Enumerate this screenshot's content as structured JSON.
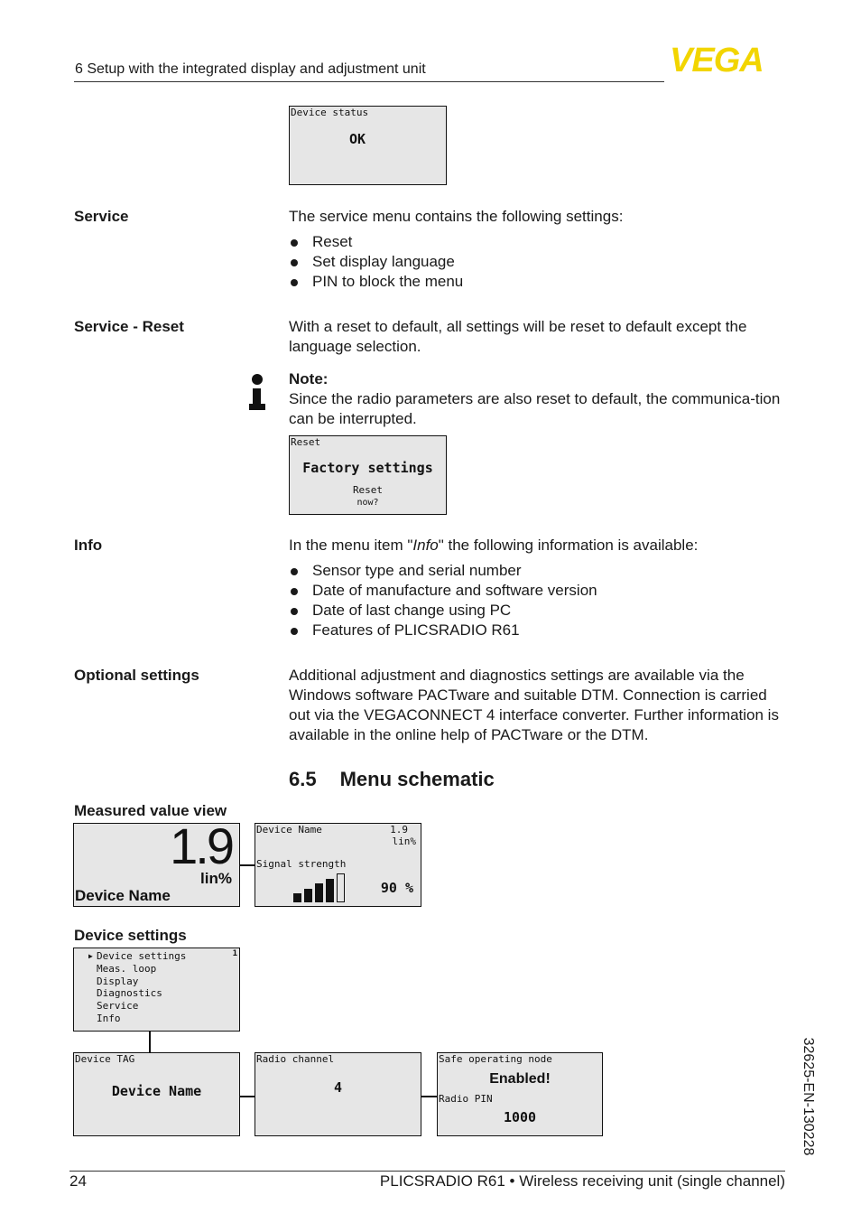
{
  "header": {
    "title": "6 Setup with the integrated display and adjustment unit",
    "logo": "VEGA",
    "brand_color": "#f2d500"
  },
  "device_status_display": {
    "title": "Device status",
    "value": "OK"
  },
  "sections": [
    {
      "label": "Service",
      "text": "The service menu contains the following settings:",
      "bullets": [
        "Reset",
        "Set display language",
        "PIN to block the menu"
      ]
    },
    {
      "label": "Service - Reset",
      "text": "With a reset to default, all settings will be reset to default except the language selection."
    },
    {
      "label": "Info",
      "text_before": "In the menu item \"",
      "text_italic": "Info",
      "text_after": "\" the following information is available:",
      "bullets": [
        "Sensor type and serial number",
        "Date of manufacture and software version",
        "Date of last change using PC",
        "Features of PLICSRADIO R61"
      ]
    },
    {
      "label": "Optional settings",
      "text": "Additional adjustment and diagnostics settings are available via the Windows software PACTware and suitable DTM. Connection is carried out via the VEGACONNECT 4 interface converter. Further information is available in the online help of PACTware or the DTM."
    }
  ],
  "note": {
    "icon": "info-icon",
    "title": "Note:",
    "text": "Since the radio parameters are also reset to default, the communica-tion can be interrupted."
  },
  "reset_display": {
    "title": "Reset",
    "value": "Factory settings",
    "line1": "Reset",
    "line2": "now?"
  },
  "section_heading": {
    "number": "6.5",
    "title": "Menu schematic"
  },
  "measured_value_view": {
    "heading": "Measured value view",
    "value": "1.9",
    "unit": "lin%",
    "name": "Device Name",
    "detail": {
      "name": "Device Name",
      "value": "1.9",
      "unit": "lin%",
      "signal_label": "Signal strength",
      "signal_percent": "90 %",
      "signal_bars_filled": 4,
      "signal_bars_total": 5
    }
  },
  "device_settings": {
    "heading": "Device settings",
    "page": "1",
    "items": [
      "Device settings",
      "Meas. loop",
      "Display",
      "Diagnostics",
      "Service",
      "Info"
    ],
    "selected": 0
  },
  "sub_displays": [
    {
      "title": "Device TAG",
      "value": "Device Name"
    },
    {
      "title": "Radio channel",
      "value": "4"
    },
    {
      "title": "Safe operating node",
      "value": "Enabled!",
      "label2": "Radio PIN",
      "value2": "1000"
    }
  ],
  "side_code": "32625-EN-130228",
  "footer": {
    "page": "24",
    "title": "PLICSRADIO R61 • Wireless receiving unit (single channel)"
  }
}
